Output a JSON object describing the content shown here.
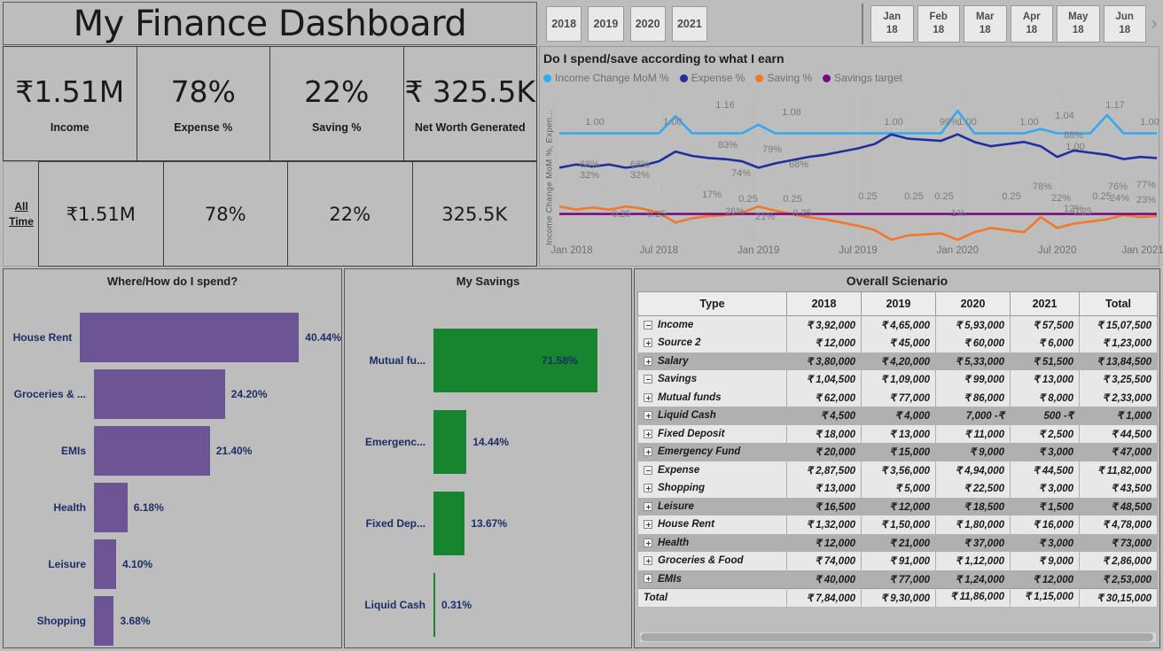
{
  "header": {
    "title": "My Finance Dashboard"
  },
  "year_slicer": {
    "name": "year-slicer",
    "options": [
      "2018",
      "2019",
      "2020",
      "2021"
    ]
  },
  "month_slicer": {
    "name": "month-slicer",
    "options": [
      {
        "month": "Jan",
        "year": "18"
      },
      {
        "month": "Feb",
        "year": "18"
      },
      {
        "month": "Mar",
        "year": "18"
      },
      {
        "month": "Apr",
        "year": "18"
      },
      {
        "month": "May",
        "year": "18"
      },
      {
        "month": "Jun",
        "year": "18"
      }
    ],
    "next_icon": "chevron-right-icon",
    "next_glyph": "›"
  },
  "kpis": [
    {
      "value": "₹1.51M",
      "label": "Income"
    },
    {
      "value": "78%",
      "label": "Expense %"
    },
    {
      "value": "22%",
      "label": "Saving %"
    },
    {
      "value": "₹ 325.5K",
      "label": "Net Worth Generated"
    }
  ],
  "time_slicer": {
    "all_time_label": "All Time",
    "values": [
      "₹1.51M",
      "78%",
      "22%",
      "325.5K"
    ]
  },
  "line_chart": {
    "title": "Do I spend/save according to what I earn",
    "ylabel": "Income Change MoM %, Expen...",
    "legend": [
      {
        "label": "Income Change MoM %",
        "color": "#35a9f0"
      },
      {
        "label": "Expense %",
        "color": "#1f2f9e"
      },
      {
        "label": "Saving %",
        "color": "#f4762a"
      },
      {
        "label": "Savings target",
        "color": "#7c0a80"
      }
    ]
  },
  "chart_data": [
    {
      "type": "line",
      "name": "income-expense-savings-trend",
      "title": "Do I spend/save according to what I earn",
      "xlabel": "",
      "ylabel": "Income Change MoM %, Expen...",
      "grid": true,
      "legend_position": "top",
      "xticks": [
        "Jan 2018",
        "Jul 2018",
        "Jan 2019",
        "Jul 2019",
        "Jan 2020",
        "Jul 2020",
        "Jan 2021"
      ],
      "x": [
        "Jan 2018",
        "Feb 2018",
        "Mar 2018",
        "Apr 2018",
        "May 2018",
        "Jun 2018",
        "Jul 2018",
        "Aug 2018",
        "Sep 2018",
        "Oct 2018",
        "Nov 2018",
        "Dec 2018",
        "Jan 2019",
        "Feb 2019",
        "Mar 2019",
        "Apr 2019",
        "May 2019",
        "Jun 2019",
        "Jul 2019",
        "Aug 2019",
        "Sep 2019",
        "Oct 2019",
        "Nov 2019",
        "Dec 2019",
        "Jan 2020",
        "Feb 2020",
        "Mar 2020",
        "Apr 2020",
        "May 2020",
        "Jun 2020",
        "Jul 2020",
        "Aug 2020",
        "Sep 2020",
        "Oct 2020",
        "Nov 2020",
        "Dec 2020",
        "Jan 2021"
      ],
      "series": [
        {
          "name": "Income Change MoM %",
          "color": "#35a9f0",
          "values": [
            1.0,
            1.0,
            1.0,
            1.0,
            1.0,
            1.0,
            1.0,
            1.16,
            1.0,
            1.0,
            1.0,
            1.0,
            1.08,
            1.0,
            1.0,
            1.0,
            1.0,
            1.0,
            1.0,
            1.0,
            1.0,
            1.0,
            1.0,
            1.0,
            1.21,
            1.0,
            1.0,
            1.0,
            1.0,
            1.04,
            1.0,
            1.0,
            1.0,
            1.17,
            1.0,
            1.0,
            1.0
          ],
          "labels": [
            "1.00",
            "1.00",
            "1.16",
            "1.08",
            "1.00",
            "1.00",
            "1.04",
            "1.21",
            "1.17",
            "1.00"
          ]
        },
        {
          "name": "Expense %",
          "color": "#1f2f9e",
          "values": [
            0.68,
            0.71,
            0.69,
            0.71,
            0.68,
            0.7,
            0.74,
            0.83,
            0.79,
            0.77,
            0.76,
            0.74,
            0.68,
            0.72,
            0.75,
            0.78,
            0.8,
            0.83,
            0.86,
            0.9,
            0.99,
            0.95,
            0.94,
            0.93,
            0.99,
            0.92,
            0.88,
            0.9,
            0.92,
            0.88,
            0.78,
            0.84,
            0.82,
            0.8,
            0.76,
            0.78,
            0.77
          ],
          "labels": [
            "68%",
            "68%",
            "74%",
            "83%",
            "79%",
            "68%",
            "99%",
            "88%",
            "78%",
            "76%",
            "77%"
          ]
        },
        {
          "name": "Saving %",
          "color": "#f4762a",
          "values": [
            0.32,
            0.29,
            0.31,
            0.29,
            0.32,
            0.3,
            0.26,
            0.17,
            0.21,
            0.23,
            0.24,
            0.26,
            0.32,
            0.28,
            0.25,
            0.22,
            0.2,
            0.17,
            0.14,
            0.1,
            0.01,
            0.05,
            0.06,
            0.07,
            0.01,
            0.08,
            0.12,
            0.1,
            0.08,
            0.22,
            0.12,
            0.16,
            0.18,
            0.2,
            0.24,
            0.22,
            0.23
          ],
          "labels": [
            "32%",
            "32%",
            "17%",
            "26%",
            "21%",
            "32%",
            "1%",
            "22%",
            "12%",
            "24%",
            "23%",
            "0.25",
            "0.25",
            "0.25",
            "0.25",
            "0.25",
            "0.25",
            "0.25",
            "0.25",
            "0.25",
            "0.25",
            "0.25",
            "0.25"
          ]
        },
        {
          "name": "Savings target",
          "color": "#7c0a80",
          "values": [
            0.25,
            0.25,
            0.25,
            0.25,
            0.25,
            0.25,
            0.25,
            0.25,
            0.25,
            0.25,
            0.25,
            0.25,
            0.25,
            0.25,
            0.25,
            0.25,
            0.25,
            0.25,
            0.25,
            0.25,
            0.25,
            0.25,
            0.25,
            0.25,
            0.25,
            0.25,
            0.25,
            0.25,
            0.25,
            0.25,
            0.25,
            0.25,
            0.25,
            0.25,
            0.25,
            0.25,
            0.25
          ],
          "labels": [
            "0.25"
          ]
        }
      ]
    },
    {
      "type": "bar",
      "orientation": "horizontal",
      "name": "where-how-do-i-spend",
      "title": "Where/How do I spend?",
      "xlabel": "",
      "ylabel": "",
      "grid": false,
      "color": "#6d5494",
      "categories": [
        "House Rent",
        "Groceries & ...",
        "EMIs",
        "Health",
        "Leisure",
        "Shopping"
      ],
      "values": [
        40.44,
        24.2,
        21.4,
        6.18,
        4.1,
        3.68
      ],
      "value_labels": [
        "40.44%",
        "24.20%",
        "21.40%",
        "6.18%",
        "4.10%",
        "3.68%"
      ],
      "xlim": [
        0,
        40.44
      ]
    },
    {
      "type": "bar",
      "orientation": "horizontal",
      "name": "my-savings",
      "title": "My Savings",
      "xlabel": "",
      "ylabel": "",
      "grid": false,
      "color": "#17842f",
      "categories": [
        "Mutual fu...",
        "Emergenc...",
        "Fixed Dep...",
        "Liquid Cash"
      ],
      "values": [
        71.58,
        14.44,
        13.67,
        0.31
      ],
      "value_labels": [
        "71.58%",
        "14.44%",
        "13.67%",
        "0.31%"
      ],
      "xlim": [
        0,
        71.58
      ]
    }
  ],
  "spend_chart": {
    "title": "Where/How do I spend?",
    "rows": [
      {
        "label": "House Rent",
        "value": "40.44%",
        "pct": 40.44
      },
      {
        "label": "Groceries & ...",
        "value": "24.20%",
        "pct": 24.2
      },
      {
        "label": "EMIs",
        "value": "21.40%",
        "pct": 21.4
      },
      {
        "label": "Health",
        "value": "6.18%",
        "pct": 6.18
      },
      {
        "label": "Leisure",
        "value": "4.10%",
        "pct": 4.1
      },
      {
        "label": "Shopping",
        "value": "3.68%",
        "pct": 3.68
      }
    ]
  },
  "savings_chart": {
    "title": "My Savings",
    "rows": [
      {
        "label": "Mutual fu...",
        "value": "71.58%",
        "pct": 71.58
      },
      {
        "label": "Emergenc...",
        "value": "14.44%",
        "pct": 14.44
      },
      {
        "label": "Fixed Dep...",
        "value": "13.67%",
        "pct": 13.67
      },
      {
        "label": "Liquid Cash",
        "value": "0.31%",
        "pct": 0.31
      }
    ]
  },
  "table": {
    "title": "Overall Scienario",
    "columns": [
      "Type",
      "2018",
      "2019",
      "2020",
      "2021",
      "Total"
    ],
    "rows": [
      {
        "type": "Income",
        "indent": 0,
        "toggle": "minus",
        "alt": false,
        "cells": [
          "₹ 3,92,000",
          "₹ 4,65,000",
          "₹ 5,93,000",
          "₹ 57,500",
          "₹ 15,07,500"
        ]
      },
      {
        "type": "Source 2",
        "indent": 1,
        "toggle": "plus",
        "alt": false,
        "cells": [
          "₹ 12,000",
          "₹ 45,000",
          "₹ 60,000",
          "₹ 6,000",
          "₹ 1,23,000"
        ]
      },
      {
        "type": "Salary",
        "indent": 1,
        "toggle": "plus",
        "alt": true,
        "cells": [
          "₹ 3,80,000",
          "₹ 4,20,000",
          "₹ 5,33,000",
          "₹ 51,500",
          "₹ 13,84,500"
        ]
      },
      {
        "type": "Savings",
        "indent": 0,
        "toggle": "minus",
        "alt": false,
        "cells": [
          "₹ 1,04,500",
          "₹ 1,09,000",
          "₹ 99,000",
          "₹ 13,000",
          "₹ 3,25,500"
        ]
      },
      {
        "type": "Mutual funds",
        "indent": 1,
        "toggle": "plus",
        "alt": false,
        "cells": [
          "₹ 62,000",
          "₹ 77,000",
          "₹ 86,000",
          "₹ 8,000",
          "₹ 2,33,000"
        ]
      },
      {
        "type": "Liquid Cash",
        "indent": 1,
        "toggle": "plus",
        "alt": true,
        "cells": [
          "₹ 4,500",
          "₹ 4,000",
          "7,000 -₹",
          "500 -₹",
          "₹ 1,000"
        ]
      },
      {
        "type": "Fixed Deposit",
        "indent": 1,
        "toggle": "plus",
        "alt": false,
        "cells": [
          "₹ 18,000",
          "₹ 13,000",
          "₹ 11,000",
          "₹ 2,500",
          "₹ 44,500"
        ]
      },
      {
        "type": "Emergency Fund",
        "indent": 1,
        "toggle": "plus",
        "alt": true,
        "cells": [
          "₹ 20,000",
          "₹ 15,000",
          "₹ 9,000",
          "₹ 3,000",
          "₹ 47,000"
        ]
      },
      {
        "type": "Expense",
        "indent": 0,
        "toggle": "minus",
        "alt": false,
        "cells": [
          "₹ 2,87,500",
          "₹ 3,56,000",
          "₹ 4,94,000",
          "₹ 44,500",
          "₹ 11,82,000"
        ]
      },
      {
        "type": "Shopping",
        "indent": 1,
        "toggle": "plus",
        "alt": false,
        "cells": [
          "₹ 13,000",
          "₹ 5,000",
          "₹ 22,500",
          "₹ 3,000",
          "₹ 43,500"
        ]
      },
      {
        "type": "Leisure",
        "indent": 1,
        "toggle": "plus",
        "alt": true,
        "cells": [
          "₹ 16,500",
          "₹ 12,000",
          "₹ 18,500",
          "₹ 1,500",
          "₹ 48,500"
        ]
      },
      {
        "type": "House Rent",
        "indent": 1,
        "toggle": "plus",
        "alt": false,
        "cells": [
          "₹ 1,32,000",
          "₹ 1,50,000",
          "₹ 1,80,000",
          "₹ 16,000",
          "₹ 4,78,000"
        ]
      },
      {
        "type": "Health",
        "indent": 1,
        "toggle": "plus",
        "alt": true,
        "cells": [
          "₹ 12,000",
          "₹ 21,000",
          "₹ 37,000",
          "₹ 3,000",
          "₹ 73,000"
        ]
      },
      {
        "type": "Groceries & Food",
        "indent": 1,
        "toggle": "plus",
        "alt": false,
        "cells": [
          "₹ 74,000",
          "₹ 91,000",
          "₹ 1,12,000",
          "₹ 9,000",
          "₹ 2,86,000"
        ]
      },
      {
        "type": "EMIs",
        "indent": 1,
        "toggle": "plus",
        "alt": true,
        "cells": [
          "₹ 40,000",
          "₹ 77,000",
          "₹ 1,24,000",
          "₹ 12,000",
          "₹ 2,53,000"
        ]
      },
      {
        "type": "Total",
        "indent": 2,
        "toggle": "none",
        "alt": false,
        "total": true,
        "cells": [
          "₹ 7,84,000",
          "₹ 9,30,000",
          "₹ 11,86,000",
          "₹ 1,15,000",
          "₹ 30,15,000"
        ]
      }
    ]
  },
  "colors": {
    "background": "#bdbdbd",
    "spend_bar": "#6d5494",
    "savings_bar": "#17842f",
    "income_line": "#35a9f0",
    "expense_line": "#1f2f9e",
    "saving_line": "#f4762a",
    "target_line": "#7c0a80",
    "bar_label": "#1b2f66"
  }
}
